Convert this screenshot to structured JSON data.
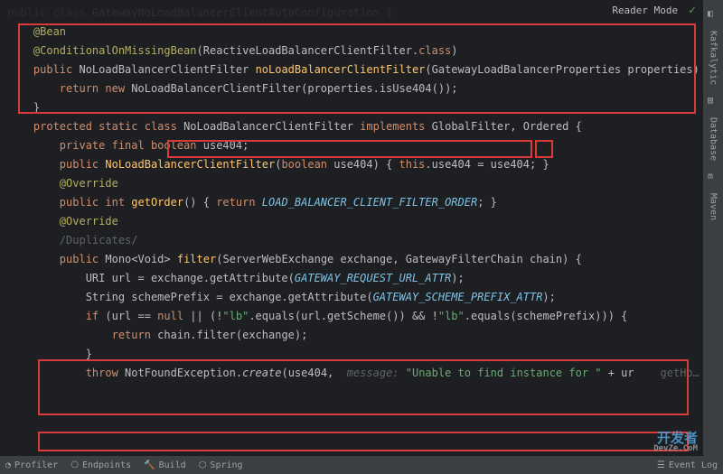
{
  "topbar": {
    "reader_mode": "Reader Mode"
  },
  "code": {
    "l1_public": "public ",
    "l1_class": "class ",
    "l1_name": "GatewayNoLoadBalancerClientAutoConfiguration ",
    "l1_brace": "{",
    "l2": "",
    "l3_ann": "    @Bean",
    "l4_ann": "    @ConditionalOnMissingBean",
    "l4_arg": "(ReactiveLoadBalancerClientFilter.",
    "l4_cls": "class",
    "l4_end": ")",
    "l5_mod": "    public ",
    "l5_type": "NoLoadBalancerClientFilter ",
    "l5_fn": "noLoadBalancerClientFilter",
    "l5_params": "(GatewayLoadBalancerProperties properties) {",
    "l6_ret": "        return new ",
    "l6_call": "NoLoadBalancerClientFilter(properties.isUse404());",
    "l7": "    }",
    "l8": "",
    "l9_mod": "    protected static class ",
    "l9_name": "NoLoadBalancerClientFilter ",
    "l9_impl": "implements ",
    "l9_ifaces": "GlobalFilter, Ordered ",
    "l9_brace": "{",
    "l10": "",
    "l11_mod": "        private final boolean ",
    "l11_var": "use404;",
    "l12": "",
    "l13_mod": "        public ",
    "l13_fn": "NoLoadBalancerClientFilter",
    "l13_params": "(",
    "l13_bool": "boolean ",
    "l13_p2": "use404) { ",
    "l13_this": "this",
    "l13_assign": ".use404 = use404; }",
    "l14": "",
    "l15_ann": "        @Override",
    "l16_mod": "        public int ",
    "l16_fn": "getOrder",
    "l16_rest": "() { ",
    "l16_ret": "return ",
    "l16_const": "LOAD_BALANCER_CLIENT_FILTER_ORDER",
    "l16_end": "; }",
    "l17": "",
    "l18_ann": "        @Override",
    "l19_dup": "        /Duplicates/",
    "l20_mod": "        public ",
    "l20_type": "Mono<Void> ",
    "l20_fn": "filter",
    "l20_params": "(ServerWebExchange exchange, GatewayFilterChain chain) {",
    "l21_pre": "            URI url = exchange.getAttribute(",
    "l21_const": "GATEWAY_REQUEST_URL_ATTR",
    "l21_end": ");",
    "l22_pre": "            String schemePrefix = exchange.getAttribute(",
    "l22_const": "GATEWAY_SCHEME_PREFIX_ATTR",
    "l22_end": ");",
    "l23_if": "            if ",
    "l23_open": "(url == ",
    "l23_null": "null ",
    "l23_or": "|| (!",
    "l23_s1": "\"lb\"",
    "l23_mid": ".equals(url.getScheme()) && !",
    "l23_s2": "\"lb\"",
    "l23_end": ".equals(schemePrefix))) {",
    "l24_ret": "                return ",
    "l24_call": "chain.filter(exchange);",
    "l25": "            }",
    "l26": "",
    "l27_throw": "            throw ",
    "l27_cls": "NotFoundException",
    "l27_dot": ".",
    "l27_create": "create",
    "l27_open": "(use404,  ",
    "l27_hint": "message: ",
    "l27_str": "\"Unable to find instance for \"",
    "l27_plus": " + ur",
    "l27_tail": "    getHo…  );"
  },
  "rightRail": {
    "t1": "Kafkalytic",
    "t2": "Database",
    "t3": "Maven"
  },
  "bottomBar": {
    "profiler": "Profiler",
    "endpoints": "Endpoints",
    "build": "Build",
    "spring": "Spring",
    "eventlog": "Event Log"
  },
  "watermark": {
    "main": "开发者",
    "sub": "DevZe.CoM"
  }
}
